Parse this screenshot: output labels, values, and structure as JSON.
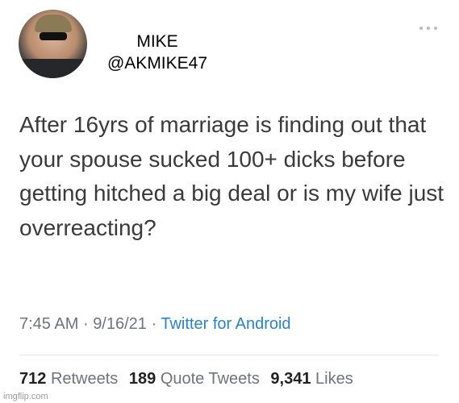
{
  "author": {
    "name": "MIKE",
    "handle": "@AKMIKE47"
  },
  "tweet": {
    "text": "After 16yrs of marriage is finding out that your spouse sucked 100+ dicks before getting hitched a big deal or is my wife just overreacting?"
  },
  "meta": {
    "time": "7:45 AM",
    "separator": "·",
    "date": "9/16/21",
    "source": "Twitter for Android"
  },
  "stats": {
    "retweets_count": "712",
    "retweets_label": "Retweets",
    "quotes_count": "189",
    "quotes_label": "Quote Tweets",
    "likes_count": "9,341",
    "likes_label": "Likes"
  },
  "watermark": "imgflip.com",
  "icons": {
    "more": "more-dots-icon"
  },
  "colors": {
    "source_link": "#2a83c4",
    "meta_text": "#6f7479",
    "tweet_text": "#3a3a3a"
  }
}
